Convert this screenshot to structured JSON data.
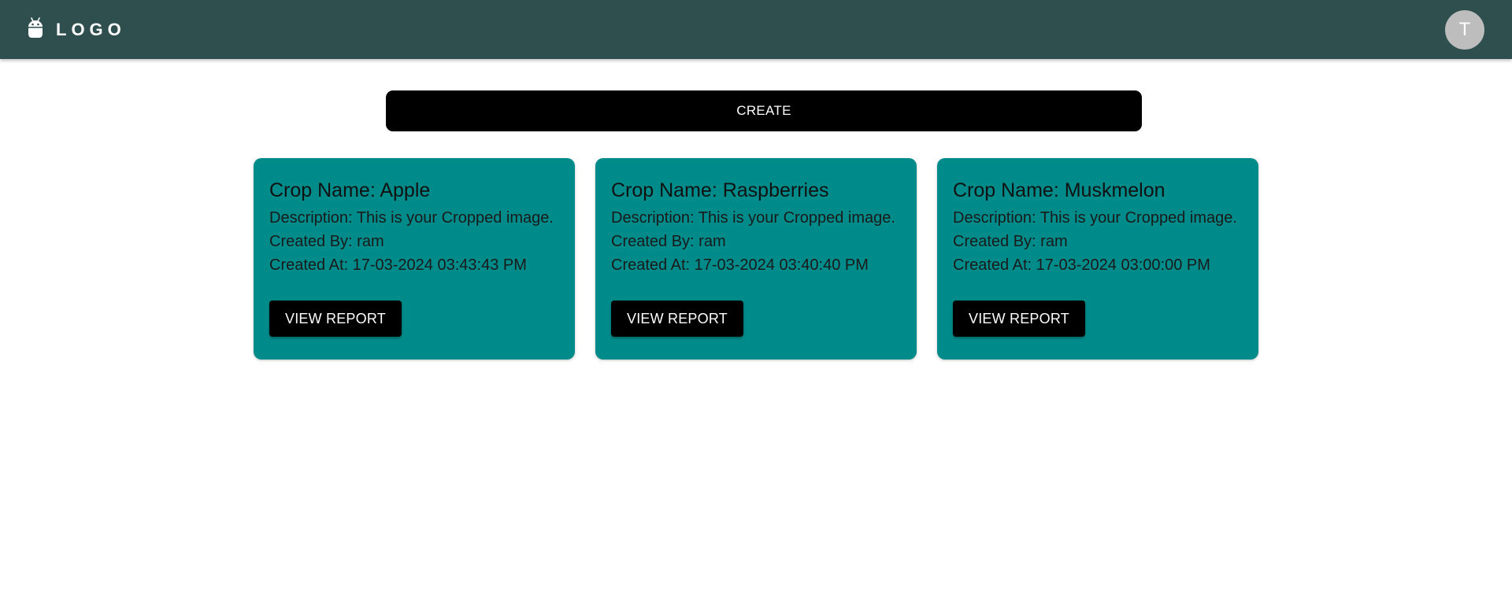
{
  "header": {
    "logo_text": "LOGO",
    "logo_icon": "android-icon",
    "avatar_initial": "T"
  },
  "actions": {
    "create_label": "CREATE"
  },
  "cards": [
    {
      "title": "Crop Name: Apple",
      "description": "Description: This is your Cropped image.",
      "created_by": "Created By: ram",
      "created_at": "Created At: 17-03-2024 03:43:43 PM",
      "button_label": "VIEW REPORT"
    },
    {
      "title": "Crop Name: Raspberries",
      "description": "Description: This is your Cropped image.",
      "created_by": "Created By: ram",
      "created_at": "Created At: 17-03-2024 03:40:40 PM",
      "button_label": "VIEW REPORT"
    },
    {
      "title": "Crop Name: Muskmelon",
      "description": "Description: This is your Cropped image.",
      "created_by": "Created By: ram",
      "created_at": "Created At: 17-03-2024 03:00:00 PM",
      "button_label": "VIEW REPORT"
    }
  ],
  "colors": {
    "appbar": "#2f4f4f",
    "card": "#008b8b",
    "button": "#000000",
    "avatar": "#bdbdbd"
  }
}
